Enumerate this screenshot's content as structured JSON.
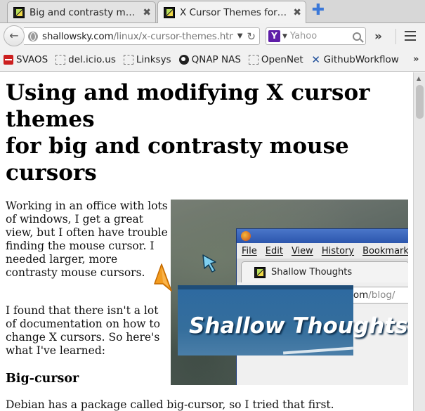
{
  "tabs": [
    {
      "title": "Big and contrasty mouse cursors",
      "close": "✖"
    },
    {
      "title": "X Cursor Themes for big mouse cursors",
      "close": "✖"
    }
  ],
  "new_tab": "✚",
  "nav": {
    "back_glyph": "←",
    "url_host": "shallowsky.com",
    "url_path": "/linux/x-cursor-themes.html",
    "url_dropdown": "▼",
    "reload_glyph": "↻",
    "search_engine_letter": "Y",
    "search_dropdown": "▼",
    "search_placeholder": "Yahoo",
    "overflow": "»"
  },
  "bookmarks": [
    {
      "label": "SVAOS",
      "icon": "svaos-icon"
    },
    {
      "label": "del.icio.us",
      "icon": "bookmark-placeholder-icon"
    },
    {
      "label": "Linksys",
      "icon": "bookmark-placeholder-icon"
    },
    {
      "label": "QNAP NAS",
      "icon": "qnap-icon"
    },
    {
      "label": "OpenNet",
      "icon": "bookmark-placeholder-icon"
    },
    {
      "label": "GithubWorkflow",
      "icon": "github-workflow-icon"
    }
  ],
  "bookmarks_overflow": "»",
  "article": {
    "title_line1": "Using and modifying X cursor themes",
    "title_line2": "for big and contrasty mouse cursors",
    "intro": "Working in an office with lots of windows, I get a great view, but I often have trouble finding the mouse cursor. I needed larger, more contrasty mouse cursors.",
    "para2": "I found that there isn't a lot of documentation on how to change X cursors. So here's what I've learned:",
    "section_heading": "Big-cursor",
    "para3": "Debian has a package called big-cursor, so I tried that first."
  },
  "figure": {
    "menus": [
      "File",
      "Edit",
      "View",
      "History",
      "Bookmarks"
    ],
    "tab_title": "Shallow Thoughts",
    "url_host": "shallowsky.com",
    "url_path": "/blog/",
    "banner_text": "Shallow Thoughts"
  },
  "colors": {
    "accent": "#3b78d8",
    "cursor_orange": "#f39c1f",
    "cursor_blue": "#7fd0f0",
    "banner_blue": "#356e9c"
  }
}
